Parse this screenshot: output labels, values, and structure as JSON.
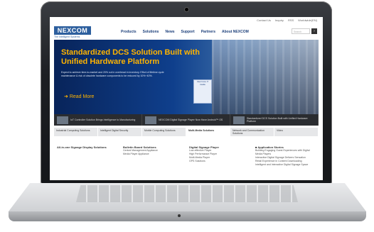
{
  "colors": {
    "brand": "#2d5f9e",
    "hero_title": "#ffb400",
    "nav": "#1c3f7a"
  },
  "top_links": [
    "Contact Us",
    "Inquiry",
    "RSS",
    "Worldwide(EN)"
  ],
  "logo": {
    "text": "NEXCOM",
    "tagline": "The Intelligent Systems"
  },
  "nav": [
    "Products",
    "Solutions",
    "News",
    "Support",
    "Partners",
    "About NEXCOM"
  ],
  "search": {
    "placeholder": "Search",
    "icon": "search-icon"
  },
  "hero": {
    "title": "Standardized DCS Solution Built with Unified Hardware Platform",
    "desc": "Expect to achieve time-to-market and 20% cut in overhead in inventory. Effort of lifetime cycle maintenance & risk of obsolete hardware components to be reduced by 10%~40%.",
    "badge": "Intel Core i7 inside",
    "read_more": "Read More"
  },
  "promos": [
    {
      "text": "IoT Controller Solution Brings Intelligence to Manufacturing"
    },
    {
      "text": "NEXCOM Digital Signage Player Now Have Android™ OS"
    },
    {
      "text": "Standardized DCS Solution Built with Unified Hardware Platform"
    }
  ],
  "tabs": [
    "Industrial Computing Solutions",
    "Intelligent Digital Security",
    "Mobile Computing Solutions",
    "Multi-Media Solutions",
    "Network and Communication Solutions",
    "Video"
  ],
  "columns": [
    {
      "heading": "All-in-one Signage Display Solutions",
      "items": []
    },
    {
      "heading": "Bulletin Board Solutions",
      "items": [
        "Central Management Appliance",
        "Media Player Appliance"
      ]
    },
    {
      "heading": "Digital Signage Player",
      "items": [
        "Low-effective Player",
        "High Performance Player",
        "Multi-Media Player",
        "GPS Solutions"
      ]
    },
    {
      "heading": "Application Stories",
      "items": [
        "Building Engaging Guest Experiences with Digital Media Players",
        "Interactive Digital Signage Delivers Sensation",
        "Retail Experience in Content Downloading",
        "Intelligent and Interactive Digital Signage Space"
      ]
    }
  ]
}
